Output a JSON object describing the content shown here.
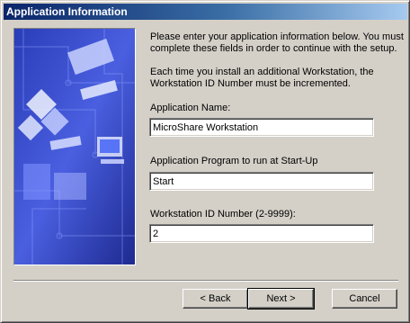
{
  "window": {
    "title": "Application Information"
  },
  "intro": {
    "line1": "Please enter your application information below.  You must",
    "line2": "complete these fields in order to continue with the setup.",
    "line3": "Each time you install an additional Workstation, the",
    "line4": "Workstation ID Number must be incremented."
  },
  "fields": {
    "app_name": {
      "label": "Application Name:",
      "value": "MicroShare Workstation"
    },
    "startup_program": {
      "label": "Application Program to run at Start-Up",
      "value": "Start"
    },
    "workstation_id": {
      "label": "Workstation ID Number (2-9999):",
      "value": "2"
    }
  },
  "buttons": {
    "back": "< Back",
    "next": "Next >",
    "cancel": "Cancel"
  }
}
